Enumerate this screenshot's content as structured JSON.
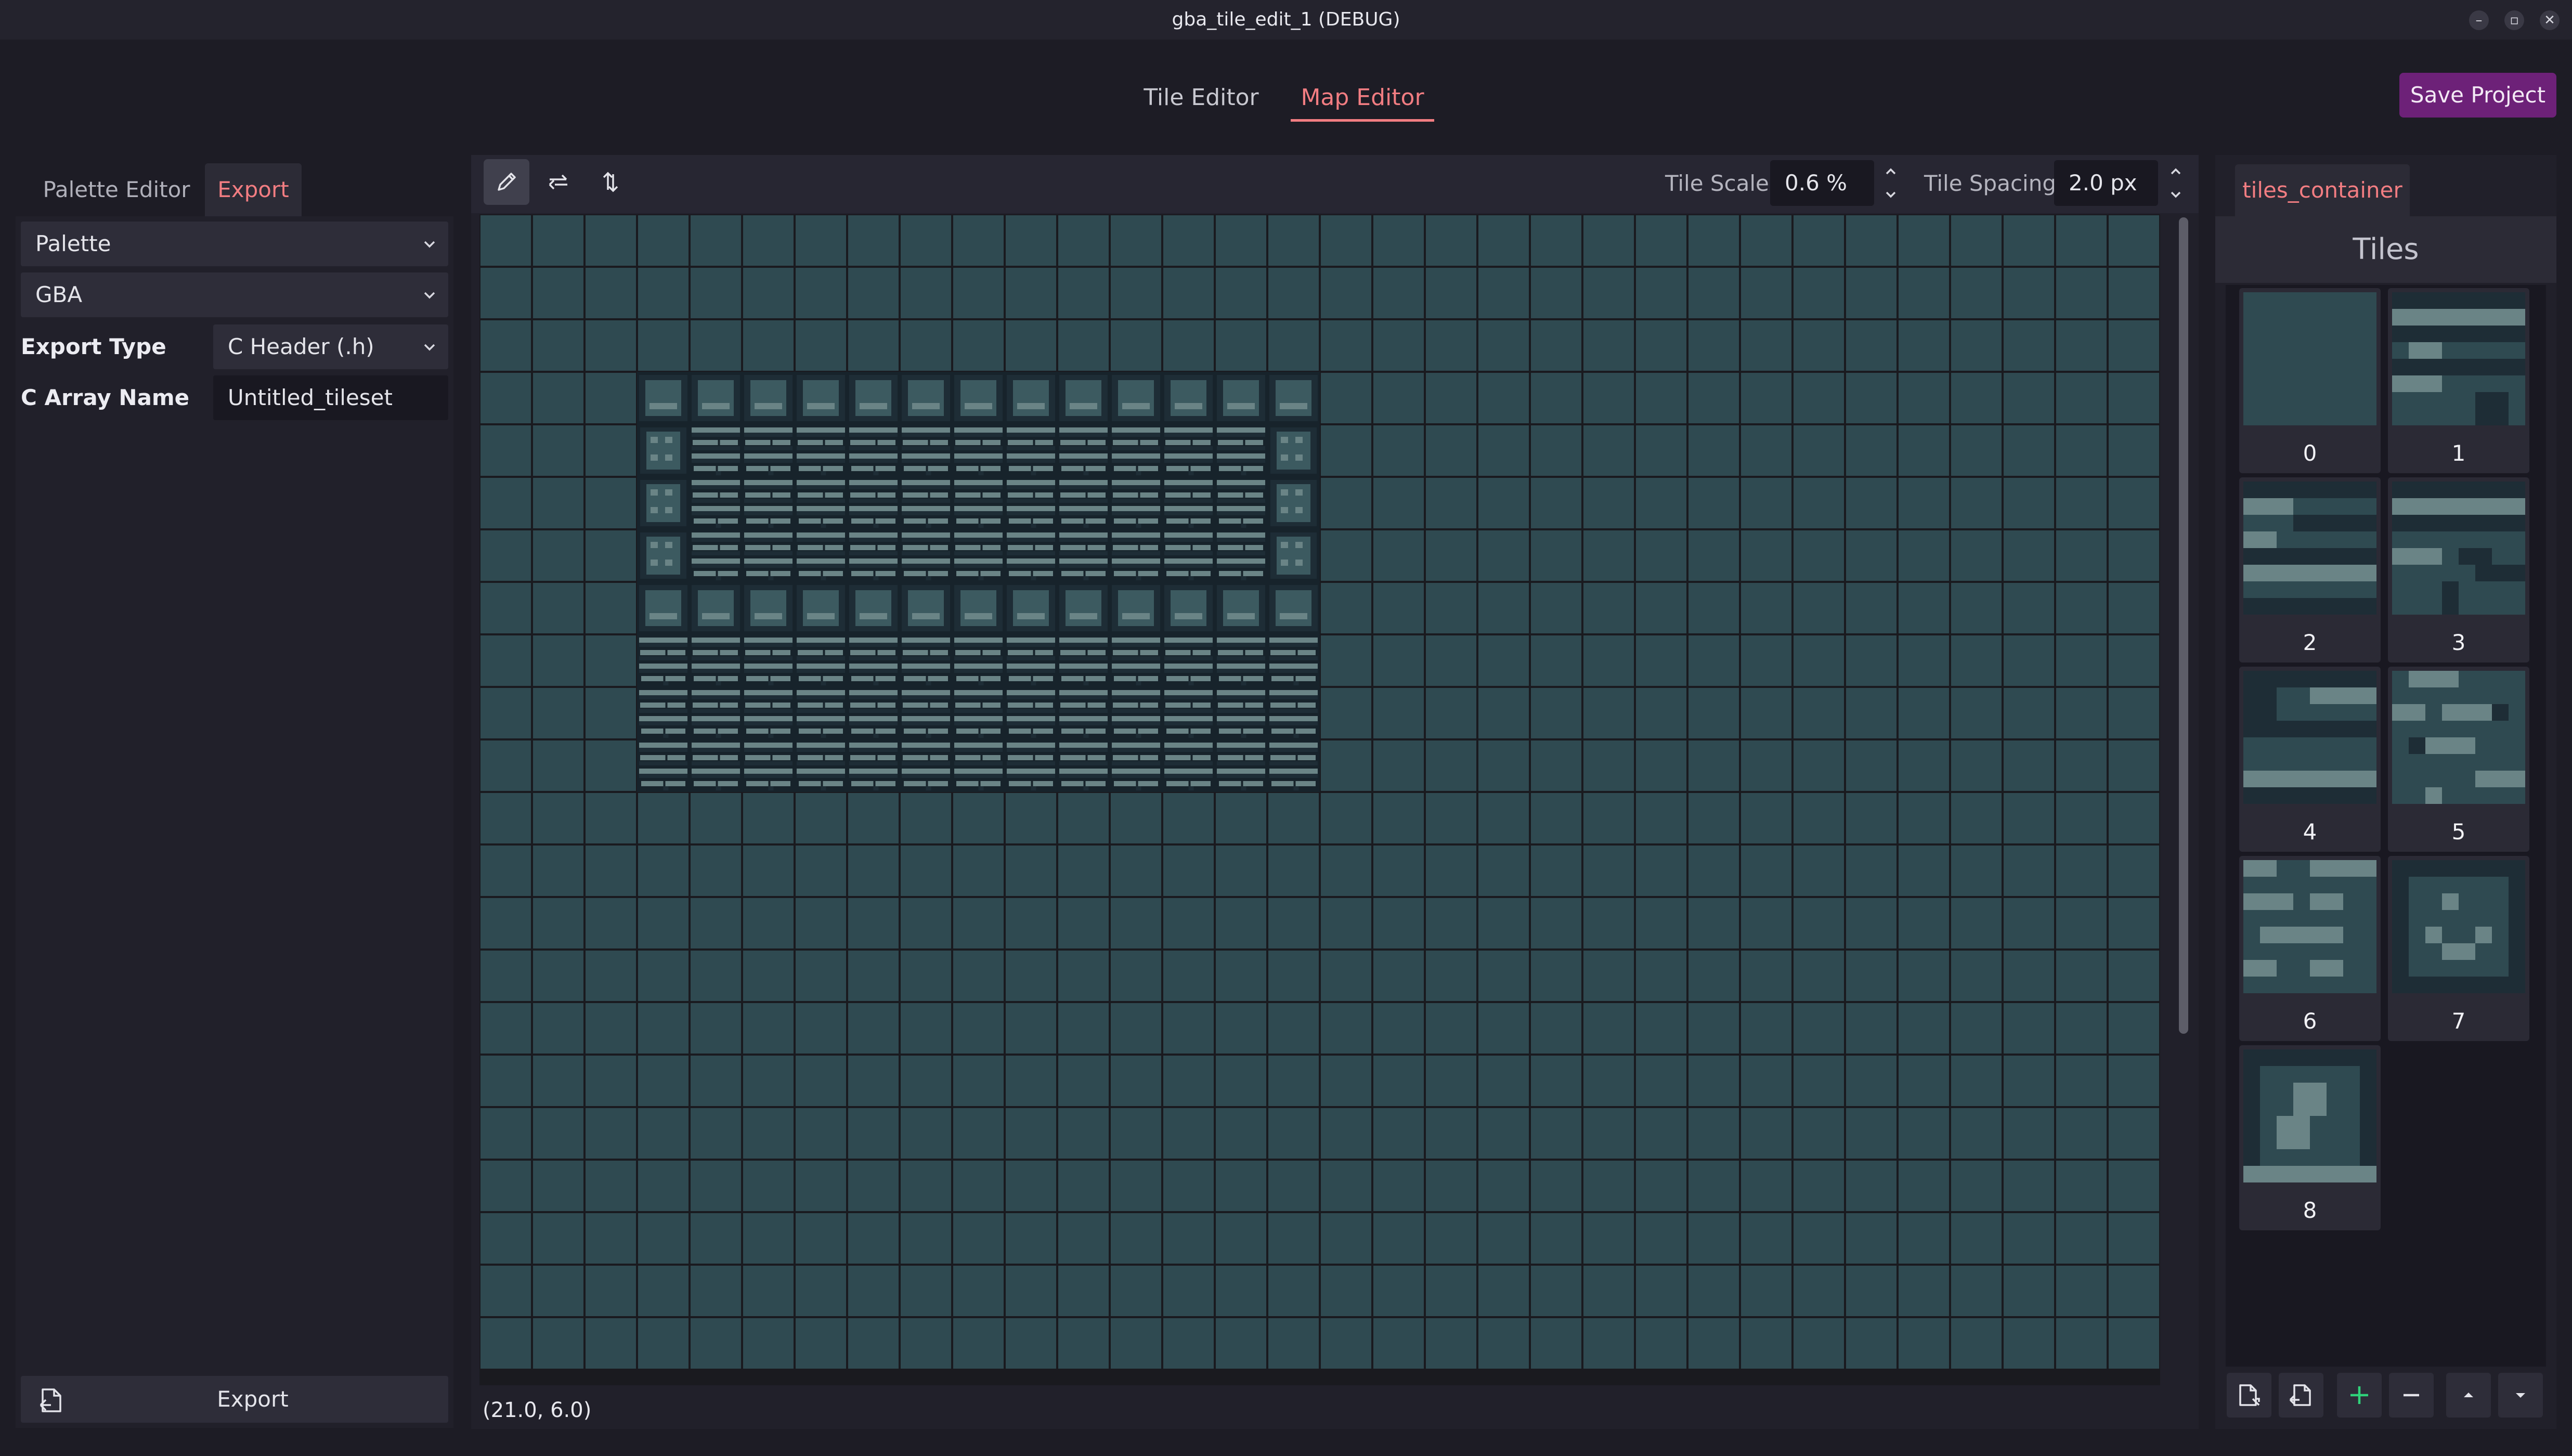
{
  "window": {
    "title": "gba_tile_edit_1 (DEBUG)",
    "min_glyph": "–",
    "max_glyph": "▫",
    "close_glyph": "✕"
  },
  "top_tabs": {
    "tile_editor": "Tile Editor",
    "map_editor": "Map Editor",
    "active": "Map Editor"
  },
  "save_button": "Save Project",
  "left_panel": {
    "tabs": {
      "palette_editor": "Palette Editor",
      "export": "Export",
      "active": "Export"
    },
    "palette_dropdown": "Palette",
    "format_dropdown": "GBA",
    "export_type_label": "Export Type",
    "export_type_value": "C Header (.h)",
    "c_array_label": "C Array Name",
    "c_array_value": "Untitled_tileset",
    "export_button": "Export",
    "export_icon": "file-export-icon"
  },
  "map_toolbar": {
    "tools": [
      "pencil-icon",
      "flip-horizontal-icon",
      "flip-vertical-icon"
    ],
    "active_tool": "pencil-icon",
    "tile_scale_label": "Tile Scale",
    "tile_scale_value": "0.6 %",
    "tile_spacing_label": "Tile Spacing",
    "tile_spacing_value": "2.0 px"
  },
  "map": {
    "columns": 32,
    "rows": 22,
    "cursor_coords": "(21.0, 6.0)"
  },
  "right_panel": {
    "tab": "tiles_container",
    "title": "Tiles",
    "tiles": [
      {
        "label": "0"
      },
      {
        "label": "1"
      },
      {
        "label": "2"
      },
      {
        "label": "3"
      },
      {
        "label": "4"
      },
      {
        "label": "5"
      },
      {
        "label": "6"
      },
      {
        "label": "7"
      },
      {
        "label": "8"
      }
    ],
    "bottom_buttons": [
      "new-file-icon",
      "open-file-icon",
      "add-icon",
      "remove-icon",
      "move-up-icon",
      "move-down-icon"
    ]
  },
  "colors": {
    "accent": "#f27d82",
    "save_button": "#6d2178",
    "tile_base": "#2f4a51",
    "tile_dark": "#1e2d36",
    "tile_light": "#6a8486",
    "grid_line": "#1a1a1f",
    "add_icon": "#2fd27a"
  }
}
